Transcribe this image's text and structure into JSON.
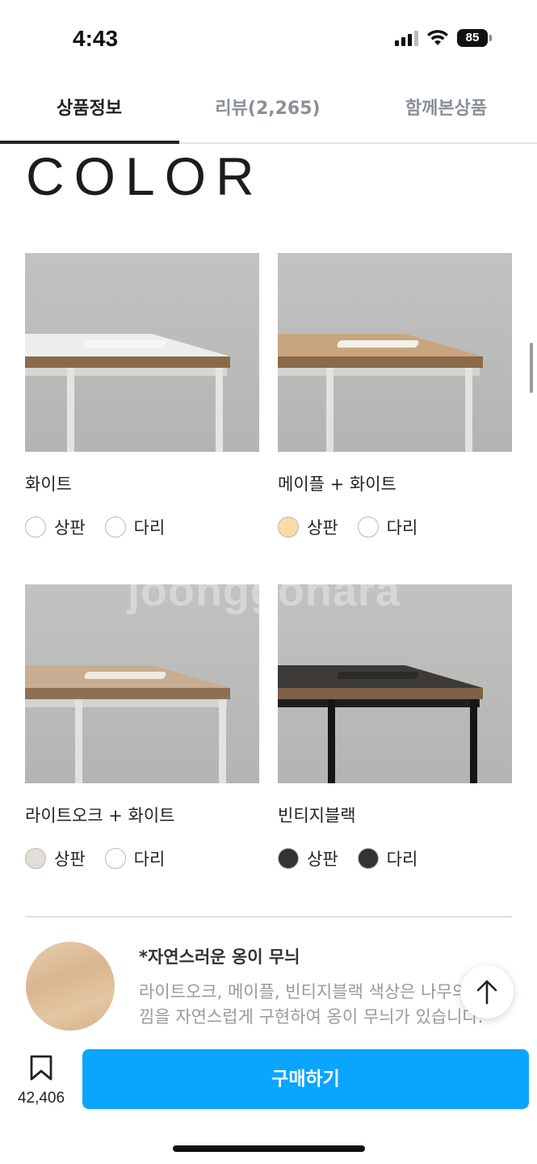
{
  "status_bar": {
    "time": "4:43",
    "battery": "85"
  },
  "tabs": [
    {
      "label": "상품정보",
      "active": true
    },
    {
      "label": "리뷰(2,265)",
      "active": false
    },
    {
      "label": "함께본상품",
      "active": false
    }
  ],
  "section_title": "COLOR",
  "watermark": "joonggonara",
  "products": [
    {
      "name": "화이트",
      "options": [
        {
          "label": "상판",
          "swatch": "#ffffff"
        },
        {
          "label": "다리",
          "swatch": "#ffffff"
        }
      ]
    },
    {
      "name": "메이플 + 화이트",
      "options": [
        {
          "label": "상판",
          "swatch": "#fcdba8"
        },
        {
          "label": "다리",
          "swatch": "#ffffff"
        }
      ]
    },
    {
      "name": "라이트오크 + 화이트",
      "options": [
        {
          "label": "상판",
          "swatch": "#e3ddd6"
        },
        {
          "label": "다리",
          "swatch": "#ffffff"
        }
      ]
    },
    {
      "name": "빈티지블랙",
      "options": [
        {
          "label": "상판",
          "swatch": "#333333"
        },
        {
          "label": "다리",
          "swatch": "#333333"
        }
      ]
    }
  ],
  "feature": {
    "title": "*자연스러운 옹이 무늬",
    "description": "라이트오크, 메이플, 빈티지블랙 색상은 나무의 느낌을 자연스럽게 구현하여 옹이 무늬가 있습니다."
  },
  "bottom_bar": {
    "bookmark_count": "42,406",
    "buy_label": "구매하기",
    "buy_color": "#0aa5ff"
  }
}
